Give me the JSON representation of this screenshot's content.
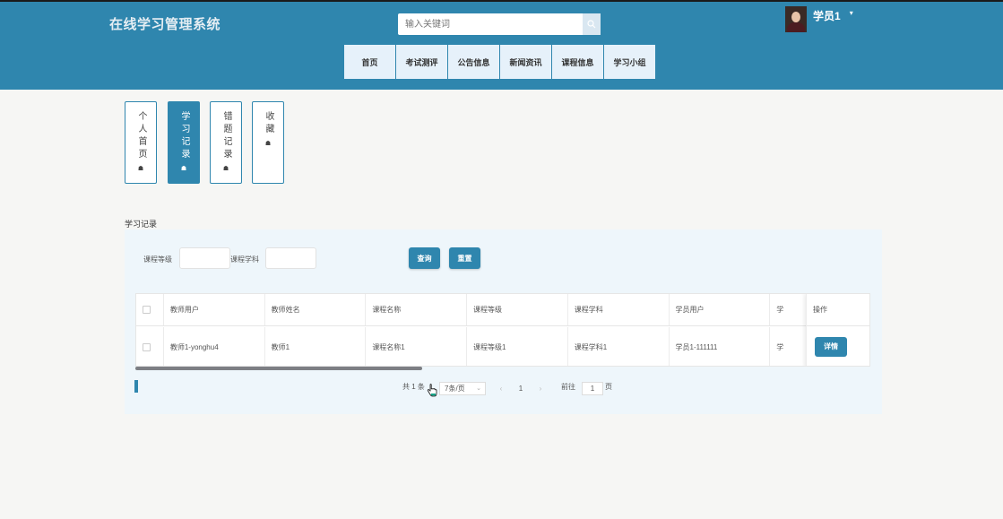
{
  "app": {
    "title": "在线学习管理系统"
  },
  "search": {
    "placeholder": "输入关键词"
  },
  "user": {
    "name": "学员1",
    "caret": "▾"
  },
  "nav": {
    "items": [
      "首页",
      "考试测评",
      "公告信息",
      "新闻资讯",
      "课程信息",
      "学习小组"
    ]
  },
  "tabs": [
    {
      "label": "个人首页",
      "icon": "☗",
      "active": false
    },
    {
      "label": "学习记录",
      "icon": "☗",
      "active": true
    },
    {
      "label": "错题记录",
      "icon": "☗",
      "active": false
    },
    {
      "label": "收藏",
      "icon": "☗",
      "active": false
    }
  ],
  "section": {
    "title": "学习记录"
  },
  "filters": {
    "course_level_label": "课程等级",
    "course_subject_label": "课程学科",
    "query_button": "查询",
    "reset_button": "重置"
  },
  "table": {
    "columns": [
      "教师用户",
      "教师姓名",
      "课程名称",
      "课程等级",
      "课程学科",
      "学员用户",
      "学"
    ],
    "rows": [
      [
        "教师1-yonghu4",
        "教师1",
        "课程名称1",
        "课程等级1",
        "课程学科1",
        "学员1-111111",
        "学"
      ]
    ],
    "op_header": "操作",
    "detail_button": "详情"
  },
  "pagination": {
    "total": "共 1 条",
    "page_size": "7条/页",
    "prev": "‹",
    "current": "1",
    "next": "›",
    "goto_label": "前往",
    "goto_value": "1",
    "page_suffix": "页"
  },
  "colors": {
    "primary": "#2f86ae",
    "nav_bg": "#e6f1fa",
    "panel_bg": "#eef6fb"
  }
}
